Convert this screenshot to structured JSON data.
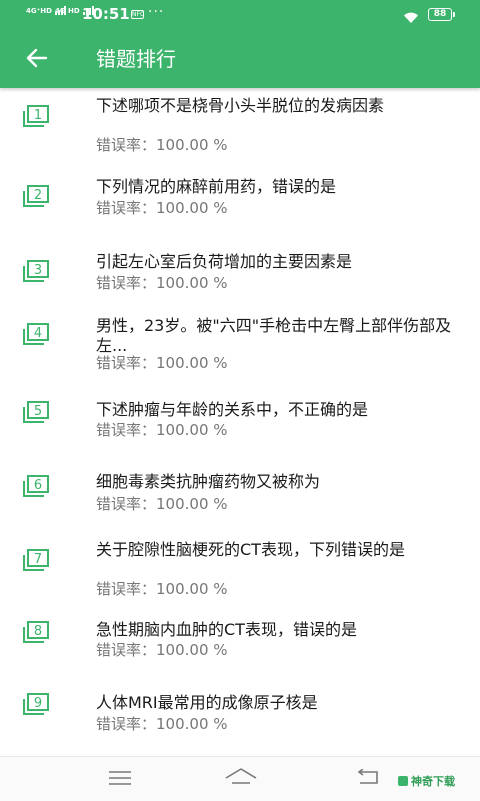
{
  "status_bar": {
    "sim1": "4G⁺HD",
    "sim2": "4G HD",
    "time": "10:51",
    "nfc": "NFC",
    "more": "···",
    "battery": "88"
  },
  "header": {
    "title": "错题排行",
    "accent_color": "#3cb46c"
  },
  "list": {
    "items": [
      {
        "num": "1",
        "question": "下述哪项不是桡骨小头半脱位的发病因素",
        "rate": "错误率：100.00 %"
      },
      {
        "num": "2",
        "question": "下列情况的麻醉前用药，错误的是",
        "rate": "错误率：100.00 %"
      },
      {
        "num": "3",
        "question": "引起左心室后负荷增加的主要因素是",
        "rate": "错误率：100.00 %"
      },
      {
        "num": "4",
        "question": "男性，23岁。被\"六四\"手枪击中左臀上部伴伤部及左...",
        "rate": "错误率：100.00 %"
      },
      {
        "num": "5",
        "question": "下述肿瘤与年龄的关系中，不正确的是",
        "rate": "错误率：100.00 %"
      },
      {
        "num": "6",
        "question": "细胞毒素类抗肿瘤药物又被称为",
        "rate": "错误率：100.00 %"
      },
      {
        "num": "7",
        "question": "关于腔隙性脑梗死的CT表现，下列错误的是",
        "rate": "错误率：100.00 %"
      },
      {
        "num": "8",
        "question": "急性期脑内血肿的CT表现，错误的是",
        "rate": "错误率：100.00 %"
      },
      {
        "num": "9",
        "question": "人体MRI最常用的成像原子核是",
        "rate": "错误率：100.00 %"
      }
    ]
  },
  "footer": {
    "logo_text": "神奇下载"
  }
}
